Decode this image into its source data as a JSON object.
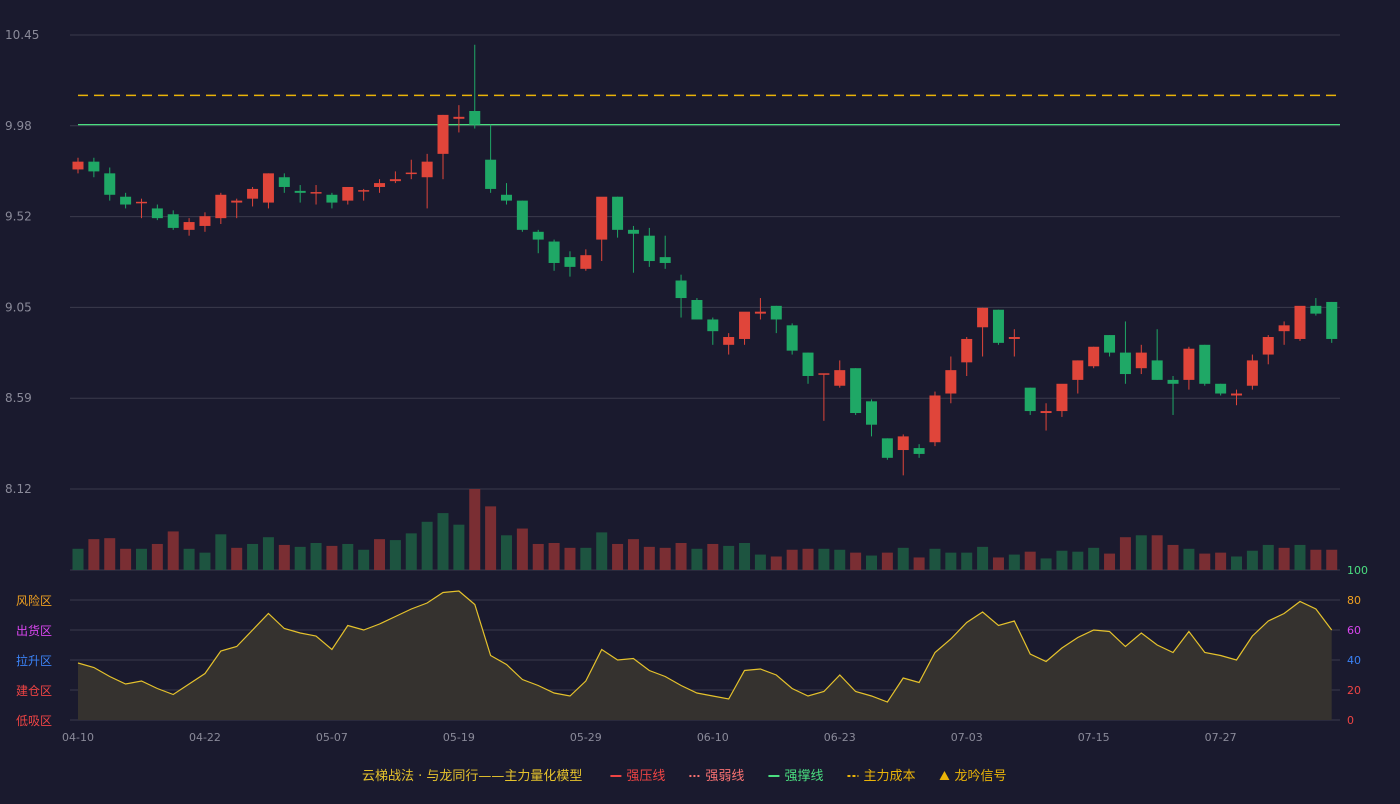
{
  "colors": {
    "background": "#1a1a2e",
    "grid": "#3a3a4c",
    "axis_text": "#8a8a99",
    "up": "#e0453a",
    "down": "#1fa866",
    "vol_up": "#7a2e33",
    "vol_down": "#1d5440",
    "indicator_line": "#e5c22c",
    "indicator_fill": "#35322f",
    "support_line": "#4ade80",
    "cost_line": "#eab308"
  },
  "chart_data": {
    "type": "candlestick",
    "price_axis": {
      "ticks": [
        "10.45",
        "9.98",
        "9.52",
        "9.05",
        "8.59",
        "8.12"
      ],
      "range": [
        8.12,
        10.45
      ]
    },
    "x_axis": {
      "labels": [
        {
          "label": "04-10",
          "index": 0
        },
        {
          "label": "04-22",
          "index": 8
        },
        {
          "label": "05-07",
          "index": 16
        },
        {
          "label": "05-19",
          "index": 24
        },
        {
          "label": "05-29",
          "index": 32
        },
        {
          "label": "06-10",
          "index": 40
        },
        {
          "label": "06-23",
          "index": 48
        },
        {
          "label": "07-03",
          "index": 56
        },
        {
          "label": "07-15",
          "index": 64
        },
        {
          "label": "07-27",
          "index": 72
        }
      ]
    },
    "reference_lines": {
      "cost_dashed": 10.14,
      "support_solid": 9.99
    },
    "candles": [
      [
        9.76,
        9.8,
        9.82,
        9.74
      ],
      [
        9.8,
        9.75,
        9.82,
        9.72
      ],
      [
        9.74,
        9.63,
        9.77,
        9.6
      ],
      [
        9.62,
        9.58,
        9.64,
        9.56
      ],
      [
        9.59,
        9.59,
        9.61,
        9.51
      ],
      [
        9.56,
        9.51,
        9.58,
        9.5
      ],
      [
        9.53,
        9.46,
        9.55,
        9.45
      ],
      [
        9.45,
        9.49,
        9.51,
        9.42
      ],
      [
        9.47,
        9.52,
        9.54,
        9.44
      ],
      [
        9.51,
        9.63,
        9.64,
        9.48
      ],
      [
        9.59,
        9.6,
        9.61,
        9.51
      ],
      [
        9.61,
        9.66,
        9.67,
        9.57
      ],
      [
        9.59,
        9.74,
        9.74,
        9.56
      ],
      [
        9.72,
        9.67,
        9.74,
        9.64
      ],
      [
        9.65,
        9.64,
        9.68,
        9.59
      ],
      [
        9.64,
        9.64,
        9.68,
        9.58
      ],
      [
        9.63,
        9.59,
        9.64,
        9.56
      ],
      [
        9.6,
        9.67,
        9.67,
        9.58
      ],
      [
        9.65,
        9.65,
        9.66,
        9.6
      ],
      [
        9.67,
        9.69,
        9.71,
        9.64
      ],
      [
        9.7,
        9.71,
        9.75,
        9.69
      ],
      [
        9.74,
        9.74,
        9.81,
        9.71
      ],
      [
        9.72,
        9.8,
        9.84,
        9.56
      ],
      [
        9.84,
        10.04,
        10.04,
        9.71
      ],
      [
        10.02,
        10.03,
        10.09,
        9.95
      ],
      [
        10.06,
        9.99,
        10.4,
        9.97
      ],
      [
        9.81,
        9.66,
        9.99,
        9.64
      ],
      [
        9.63,
        9.6,
        9.69,
        9.58
      ],
      [
        9.6,
        9.45,
        9.6,
        9.44
      ],
      [
        9.44,
        9.4,
        9.45,
        9.33
      ],
      [
        9.39,
        9.28,
        9.4,
        9.24
      ],
      [
        9.31,
        9.26,
        9.34,
        9.21
      ],
      [
        9.25,
        9.32,
        9.35,
        9.24
      ],
      [
        9.4,
        9.62,
        9.61,
        9.29
      ],
      [
        9.62,
        9.45,
        9.62,
        9.41
      ],
      [
        9.45,
        9.43,
        9.47,
        9.23
      ],
      [
        9.42,
        9.29,
        9.46,
        9.26
      ],
      [
        9.31,
        9.28,
        9.42,
        9.25
      ],
      [
        9.19,
        9.1,
        9.22,
        9.0
      ],
      [
        9.09,
        8.99,
        9.1,
        8.99
      ],
      [
        8.99,
        8.93,
        9.0,
        8.86
      ],
      [
        8.86,
        8.9,
        8.92,
        8.81
      ],
      [
        8.89,
        9.03,
        9.02,
        8.86
      ],
      [
        9.02,
        9.03,
        9.1,
        8.99
      ],
      [
        9.06,
        8.99,
        9.06,
        8.92
      ],
      [
        8.96,
        8.83,
        8.97,
        8.81
      ],
      [
        8.82,
        8.7,
        8.82,
        8.66
      ],
      [
        8.71,
        8.71,
        8.71,
        8.47
      ],
      [
        8.65,
        8.73,
        8.78,
        8.64
      ],
      [
        8.74,
        8.51,
        8.74,
        8.5
      ],
      [
        8.57,
        8.45,
        8.58,
        8.39
      ],
      [
        8.38,
        8.28,
        8.38,
        8.27
      ],
      [
        8.32,
        8.39,
        8.4,
        8.19
      ],
      [
        8.33,
        8.3,
        8.35,
        8.28
      ],
      [
        8.36,
        8.6,
        8.62,
        8.34
      ],
      [
        8.61,
        8.73,
        8.8,
        8.56
      ],
      [
        8.77,
        8.89,
        8.9,
        8.7
      ],
      [
        8.95,
        9.05,
        9.05,
        8.8
      ],
      [
        9.04,
        8.87,
        9.04,
        8.86
      ],
      [
        8.89,
        8.9,
        8.94,
        8.8
      ],
      [
        8.64,
        8.52,
        8.64,
        8.5
      ],
      [
        8.51,
        8.52,
        8.56,
        8.42
      ],
      [
        8.52,
        8.66,
        8.63,
        8.49
      ],
      [
        8.68,
        8.78,
        8.78,
        8.61
      ],
      [
        8.75,
        8.85,
        8.85,
        8.74
      ],
      [
        8.91,
        8.82,
        8.91,
        8.8
      ],
      [
        8.82,
        8.71,
        8.98,
        8.66
      ],
      [
        8.74,
        8.82,
        8.86,
        8.71
      ],
      [
        8.78,
        8.68,
        8.94,
        8.68
      ],
      [
        8.68,
        8.66,
        8.7,
        8.5
      ],
      [
        8.68,
        8.84,
        8.85,
        8.63
      ],
      [
        8.86,
        8.66,
        8.86,
        8.65
      ],
      [
        8.66,
        8.61,
        8.66,
        8.6
      ],
      [
        8.6,
        8.61,
        8.63,
        8.55
      ],
      [
        8.65,
        8.78,
        8.81,
        8.63
      ],
      [
        8.81,
        8.9,
        8.91,
        8.76
      ],
      [
        8.93,
        8.96,
        8.98,
        8.86
      ],
      [
        8.89,
        9.06,
        9.05,
        8.88
      ],
      [
        9.06,
        9.02,
        9.1,
        9.01
      ],
      [
        9.08,
        8.89,
        9.08,
        8.87
      ]
    ],
    "volume_panel": {
      "top_label": "100"
    },
    "volume": [
      [
        22,
        1
      ],
      [
        32,
        0
      ],
      [
        33,
        0
      ],
      [
        22,
        0
      ],
      [
        22,
        1
      ],
      [
        27,
        0
      ],
      [
        40,
        0
      ],
      [
        22,
        1
      ],
      [
        18,
        1
      ],
      [
        37,
        1
      ],
      [
        23,
        0
      ],
      [
        27,
        1
      ],
      [
        34,
        1
      ],
      [
        26,
        0
      ],
      [
        24,
        1
      ],
      [
        28,
        1
      ],
      [
        25,
        0
      ],
      [
        27,
        1
      ],
      [
        21,
        1
      ],
      [
        32,
        0
      ],
      [
        31,
        1
      ],
      [
        38,
        1
      ],
      [
        50,
        1
      ],
      [
        59,
        1
      ],
      [
        47,
        1
      ],
      [
        84,
        0
      ],
      [
        66,
        0
      ],
      [
        36,
        1
      ],
      [
        43,
        0
      ],
      [
        27,
        0
      ],
      [
        28,
        0
      ],
      [
        23,
        0
      ],
      [
        23,
        1
      ],
      [
        39,
        1
      ],
      [
        27,
        0
      ],
      [
        32,
        0
      ],
      [
        24,
        0
      ],
      [
        23,
        0
      ],
      [
        28,
        0
      ],
      [
        22,
        1
      ],
      [
        27,
        0
      ],
      [
        25,
        1
      ],
      [
        28,
        1
      ],
      [
        16,
        1
      ],
      [
        14,
        0
      ],
      [
        21,
        0
      ],
      [
        22,
        0
      ],
      [
        22,
        1
      ],
      [
        21,
        1
      ],
      [
        18,
        0
      ],
      [
        15,
        1
      ],
      [
        18,
        0
      ],
      [
        23,
        1
      ],
      [
        13,
        0
      ],
      [
        22,
        1
      ],
      [
        18,
        1
      ],
      [
        18,
        1
      ],
      [
        24,
        1
      ],
      [
        13,
        0
      ],
      [
        16,
        1
      ],
      [
        19,
        0
      ],
      [
        12,
        1
      ],
      [
        20,
        1
      ],
      [
        19,
        1
      ],
      [
        23,
        1
      ],
      [
        17,
        0
      ],
      [
        34,
        0
      ],
      [
        36,
        1
      ],
      [
        36,
        0
      ],
      [
        26,
        0
      ],
      [
        22,
        1
      ],
      [
        17,
        0
      ],
      [
        18,
        0
      ],
      [
        14,
        1
      ],
      [
        20,
        1
      ],
      [
        26,
        1
      ],
      [
        23,
        0
      ],
      [
        26,
        1
      ],
      [
        21,
        0
      ],
      [
        21,
        0
      ]
    ],
    "indicator": {
      "zones": [
        {
          "label": "风险区",
          "color": "#f0a020",
          "value": 80
        },
        {
          "label": "出货区",
          "color": "#d946ef",
          "value": 60
        },
        {
          "label": "拉升区",
          "color": "#3b82f6",
          "value": 40
        },
        {
          "label": "建仓区",
          "color": "#ef4444",
          "value": 20
        },
        {
          "label": "低吸区",
          "color": "#ef4444",
          "value": 0
        }
      ],
      "right_ticks": [
        {
          "label": "100",
          "color": "#4ade80"
        },
        {
          "label": "80",
          "color": "#f0a020"
        },
        {
          "label": "60",
          "color": "#d946ef"
        },
        {
          "label": "40",
          "color": "#3b82f6"
        },
        {
          "label": "20",
          "color": "#ef4444"
        },
        {
          "label": "0",
          "color": "#ef4444"
        }
      ],
      "range": [
        0,
        80
      ],
      "values": [
        38,
        35,
        29,
        24,
        26,
        21,
        17,
        24,
        31,
        46,
        49,
        60,
        71,
        61,
        58,
        56,
        47,
        63,
        60,
        64,
        69,
        74,
        78,
        85,
        86,
        77,
        43,
        37,
        27,
        23,
        18,
        16,
        26,
        47,
        40,
        41,
        33,
        29,
        23,
        18,
        16,
        14,
        33,
        34,
        30,
        21,
        16,
        19,
        30,
        19,
        16,
        12,
        28,
        25,
        45,
        54,
        65,
        72,
        63,
        66,
        44,
        39,
        48,
        55,
        60,
        59,
        49,
        58,
        50,
        45,
        59,
        45,
        43,
        40,
        56,
        66,
        71,
        79,
        74,
        60
      ]
    },
    "legend": [
      {
        "label": "云梯战法 · 与龙同行——主力量化模型",
        "color": "#e5c22c",
        "marker": "none"
      },
      {
        "label": "强压线",
        "color": "#ef4444",
        "marker": "solid"
      },
      {
        "label": "强弱线",
        "color": "#f87171",
        "marker": "dotted"
      },
      {
        "label": "强撑线",
        "color": "#4ade80",
        "marker": "solid"
      },
      {
        "label": "主力成本",
        "color": "#eab308",
        "marker": "dashed"
      },
      {
        "label": "龙吟信号",
        "color": "#eab308",
        "marker": "triangle"
      }
    ]
  }
}
